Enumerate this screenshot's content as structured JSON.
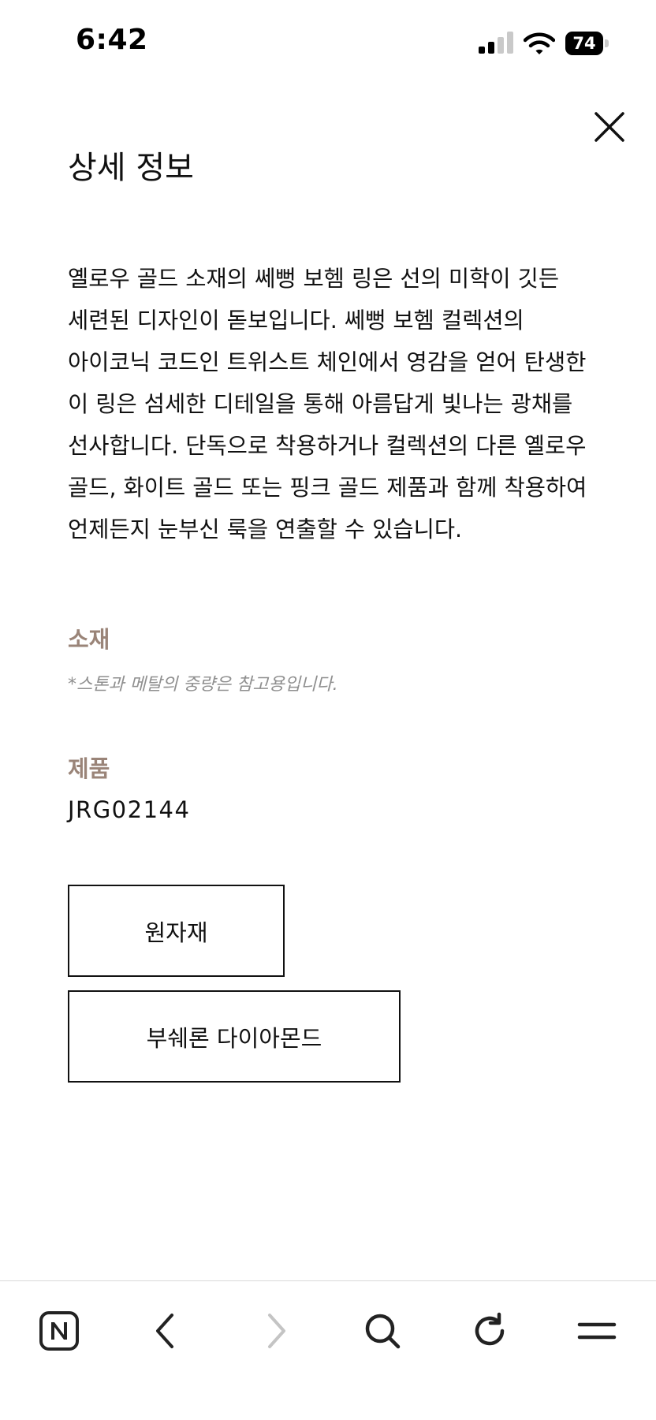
{
  "status_bar": {
    "time": "6:42",
    "battery": "74"
  },
  "page": {
    "title": "상세 정보",
    "description": "옐로우 골드 소재의 쎄뻥 보헴 링은 선의 미학이 깃든 세련된 디자인이 돋보입니다. 쎄뻥 보헴 컬렉션의 아이코닉 코드인 트위스트 체인에서 영감을 얻어 탄생한 이 링은 섬세한 디테일을 통해 아름답게 빛나는 광채를 선사합니다. 단독으로 착용하거나 컬렉션의 다른 옐로우 골드, 화이트 골드 또는 핑크 골드 제품과 함께 착용하여 언제든지 눈부신 룩을 연출할 수 있습니다."
  },
  "material": {
    "label": "소재",
    "note": "*스톤과 메탈의 중량은 참고용입니다."
  },
  "product": {
    "label": "제품",
    "code": "JRG02144"
  },
  "chips": {
    "raw_material": "원자재",
    "diamond": "부쉐론 다이아몬드"
  },
  "toolbar": {
    "icons": [
      "naver-home-icon",
      "back-arrow-icon",
      "forward-arrow-icon",
      "search-icon",
      "reload-icon",
      "menu-icon"
    ]
  },
  "colors": {
    "accent_label": "#9a8478",
    "note_text": "#8f8f8f",
    "text": "#111111",
    "disabled_icon": "#c4c4c4"
  }
}
